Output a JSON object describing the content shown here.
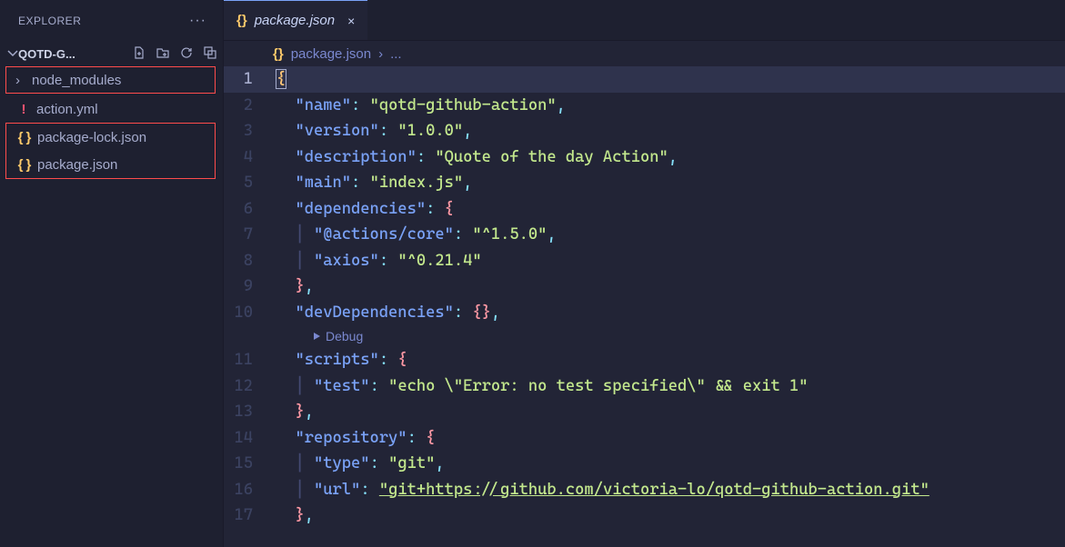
{
  "sidebar": {
    "title": "EXPLORER",
    "folder": "QOTD-G...",
    "items": [
      {
        "name": "node_modules",
        "kind": "folder"
      },
      {
        "name": "action.yml",
        "kind": "yml"
      },
      {
        "name": "package-lock.json",
        "kind": "json"
      },
      {
        "name": "package.json",
        "kind": "json"
      }
    ]
  },
  "tab": {
    "icon": "{}",
    "label": "package.json",
    "close": "×"
  },
  "breadcrumb": {
    "icon": "{}",
    "file": "package.json",
    "sep": "›",
    "more": "..."
  },
  "codelens": "Debug",
  "lines": {
    "l1": {
      "n": "1"
    },
    "l2": {
      "n": "2",
      "k": "\"name\"",
      "v": "\"qotd-github-action\""
    },
    "l3": {
      "n": "3",
      "k": "\"version\"",
      "v": "\"1.0.0\""
    },
    "l4": {
      "n": "4",
      "k": "\"description\"",
      "v": "\"Quote of the day Action\""
    },
    "l5": {
      "n": "5",
      "k": "\"main\"",
      "v": "\"index.js\""
    },
    "l6": {
      "n": "6",
      "k": "\"dependencies\""
    },
    "l7": {
      "n": "7",
      "k": "\"@actions/core\"",
      "v": "\"^1.5.0\""
    },
    "l8": {
      "n": "8",
      "k": "\"axios\"",
      "v": "\"^0.21.4\""
    },
    "l9": {
      "n": "9"
    },
    "l10": {
      "n": "10",
      "k": "\"devDependencies\""
    },
    "l11": {
      "n": "11",
      "k": "\"scripts\""
    },
    "l12": {
      "n": "12",
      "k": "\"test\"",
      "v": "\"echo \\\"Error: no test specified\\\" && exit 1\""
    },
    "l13": {
      "n": "13"
    },
    "l14": {
      "n": "14",
      "k": "\"repository\""
    },
    "l15": {
      "n": "15",
      "k": "\"type\"",
      "v": "\"git\""
    },
    "l16": {
      "n": "16",
      "k": "\"url\"",
      "v": "\"git+https://github.com/victoria-lo/qotd-github-action.git\""
    },
    "l17": {
      "n": "17"
    }
  }
}
